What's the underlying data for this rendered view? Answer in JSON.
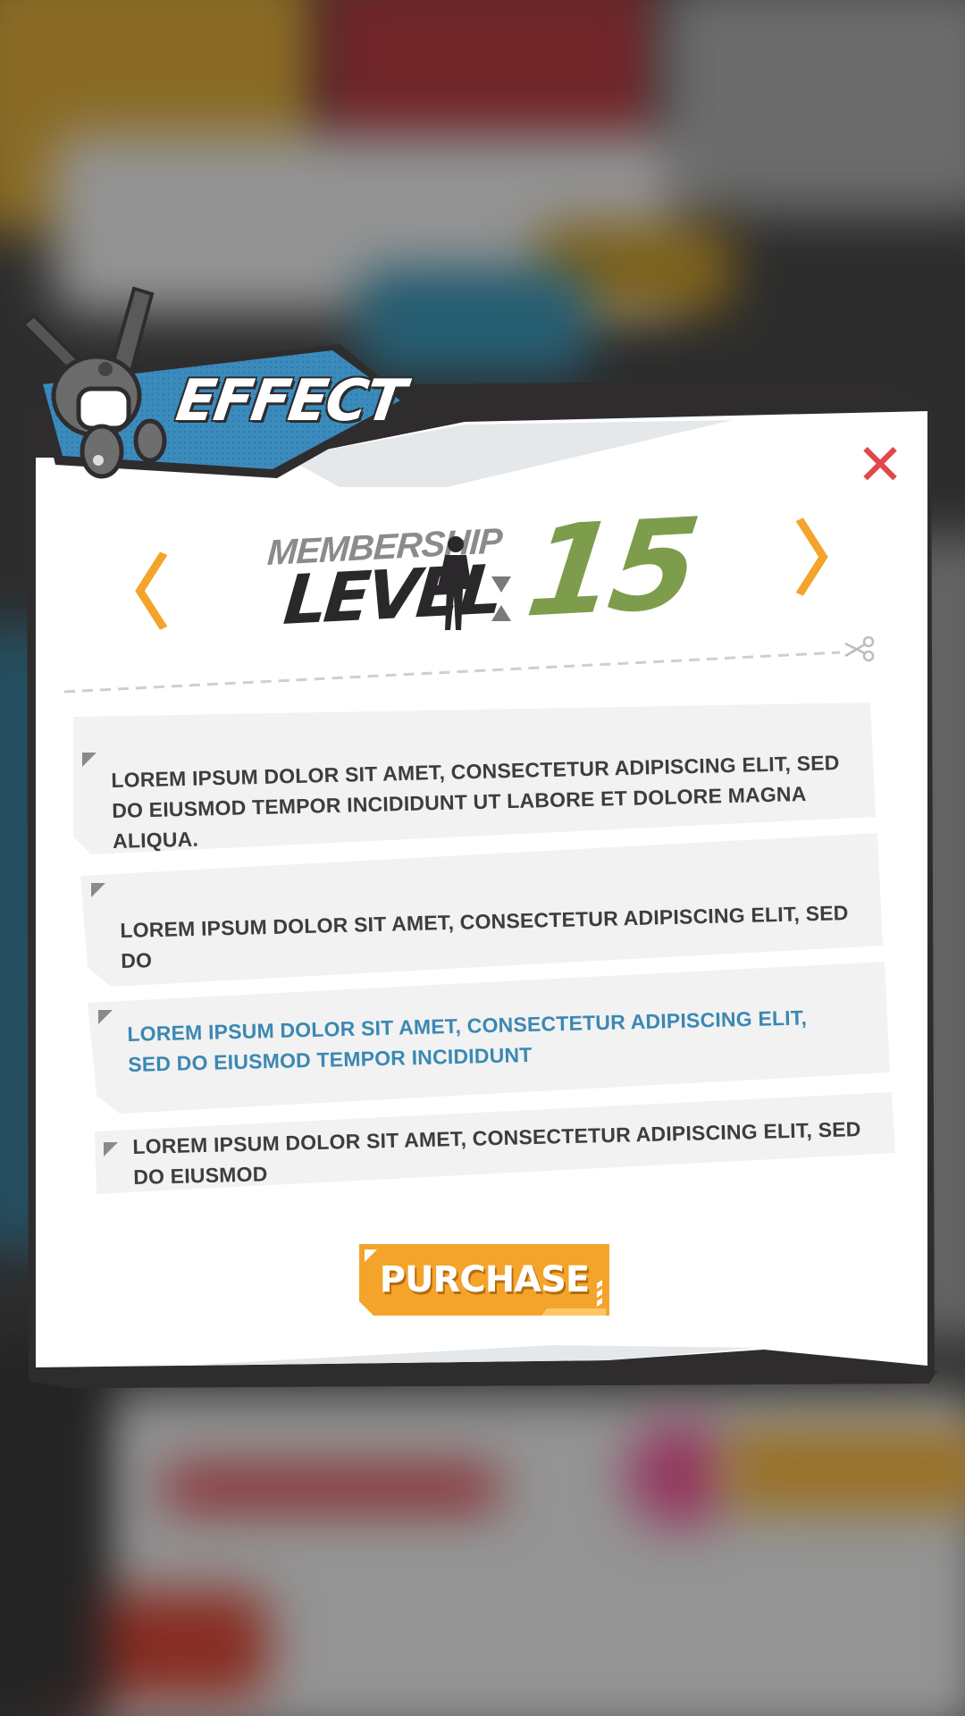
{
  "dialog": {
    "tab_title": "EFFECT",
    "close_symbol": "✕",
    "prev_symbol": "〈",
    "next_symbol": "〉",
    "level_label_small": "MEMBERSHIP",
    "level_label_big": "LEVEL",
    "level_value": "15",
    "effects": [
      {
        "text": "LOREM IPSUM DOLOR SIT AMET, CONSECTETUR ADIPISCING ELIT, SED DO EIUSMOD TEMPOR INCIDIDUNT UT LABORE ET DOLORE MAGNA ALIQUA.",
        "highlight": false
      },
      {
        "text": "LOREM IPSUM DOLOR SIT AMET, CONSECTETUR ADIPISCING ELIT, SED DO",
        "highlight": false
      },
      {
        "text": "LOREM IPSUM DOLOR SIT AMET, CONSECTETUR ADIPISCING ELIT, SED DO EIUSMOD TEMPOR INCIDIDUNT",
        "highlight": true
      },
      {
        "text": "LOREM IPSUM DOLOR SIT AMET, CONSECTETUR ADIPISCING ELIT, SED DO EIUSMOD",
        "highlight": false
      }
    ],
    "purchase_label": "PURCHASE"
  },
  "icons": [
    "rabbit-mascot-icon",
    "silhouette-icon",
    "scissors-icon",
    "close-icon",
    "arrow-left-icon",
    "arrow-right-icon"
  ],
  "colors": {
    "accent_orange": "#f4a42a",
    "level_green": "#7d9d4c",
    "highlight_blue": "#3b88b3",
    "close_red": "#e2474b",
    "frame_dark": "#2f2c2e",
    "tab_blue": "#3b8bbd"
  }
}
